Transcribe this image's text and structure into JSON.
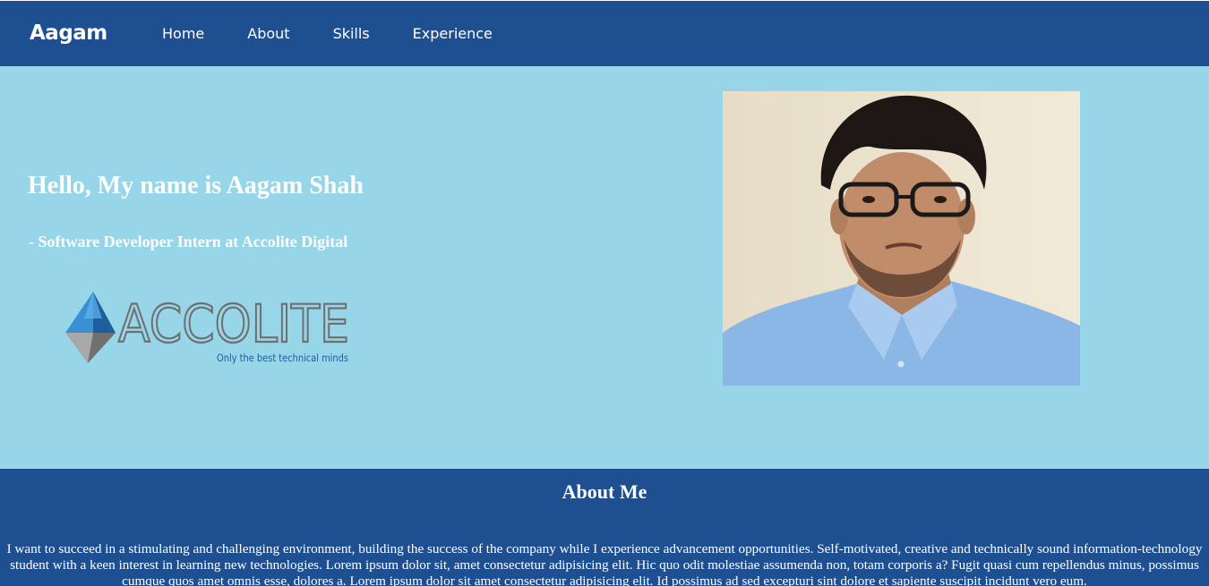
{
  "navbar": {
    "brand": "Aagam",
    "links": [
      "Home",
      "About",
      "Skills",
      "Experience"
    ],
    "background": "#1e4f91"
  },
  "hero": {
    "background": "#97d5e8",
    "title": "Hello, My name is Aagam Shah",
    "subtitle": "- Software Developer Intern at Accolite Digital",
    "logo": {
      "wordmark": "ACCOLITE",
      "tagline": "Only the best technical minds"
    },
    "photo_icon": "profile-photo"
  },
  "about": {
    "title": "About Me",
    "text": "I want to succeed in a stimulating and challenging environment, building the success of the company while I experience advancement opportunities. Self-motivated, creative and technically sound information-technology student with a keen interest in learning new technologies. Lorem ipsum dolor sit, amet consectetur adipisicing elit. Hic quo odit molestiae assumenda non, totam corporis a? Fugit quasi cum repellendus minus, possimus cumque quos amet omnis esse, dolores a. Lorem ipsum dolor sit amet consectetur adipisicing elit. Id possimus ad sed excepturi sint dolore et sapiente suscipit incidunt vero eum."
  }
}
